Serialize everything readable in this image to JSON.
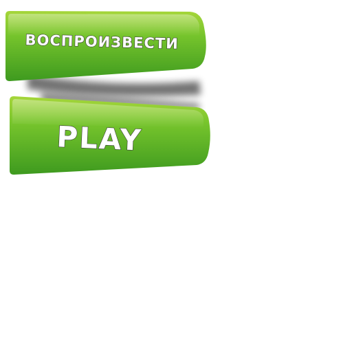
{
  "buttons": {
    "top": {
      "label": "ВОСПРОИЗВЕСТИ"
    },
    "bottom": {
      "label": "PLAY"
    }
  },
  "colors": {
    "button_top_light": "#9acd32",
    "button_mid": "#6bbf2a",
    "button_bottom_dark": "#3f9d1e",
    "text_fill": "#ffffff",
    "text_outline": "#3a3a3a",
    "background": "#ffffff"
  }
}
